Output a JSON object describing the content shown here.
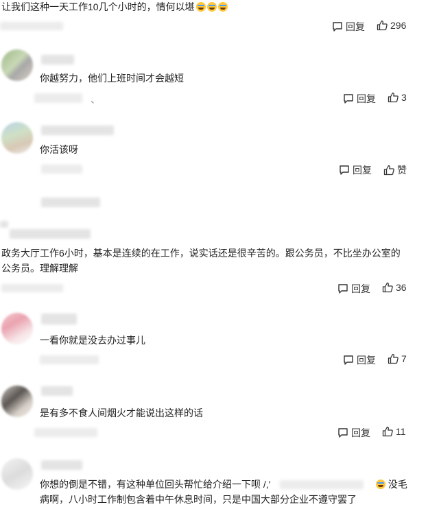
{
  "top": {
    "text": "让我们这种一天工作10几个小时的，情何以堪",
    "emoji": "😭😭😭",
    "reply": "回复",
    "likes": "296"
  },
  "comments": [
    {
      "text": "你越努力，他们上班时间才会越短",
      "reply": "回复",
      "likes": "3",
      "tail": "、"
    },
    {
      "text": "你活该呀",
      "reply": "回复",
      "likes": "赞"
    },
    {
      "text1": "政务大厅工作6小时，基本是连续的在工作，说实话还是很辛苦的。跟公务员，不比坐办公室的",
      "text2": "公务员。理解理解",
      "reply": "回复",
      "likes": "36"
    },
    {
      "text": "一看你就是没去办过事儿",
      "reply": "回复",
      "likes": "7"
    },
    {
      "text": "是有多不食人间烟火才能说出这样的话",
      "reply": "回复",
      "likes": "11"
    },
    {
      "text1a": "你想的倒是不错，有这种单位回头帮忙给介绍一下呗 /,'",
      "text1b": "没毛",
      "text2": "病啊，八小时工作制包含着中午休息时间，只是中国大部分企业不遵守罢了",
      "emoji": "😪"
    }
  ],
  "colors": {
    "text": "#222222",
    "action": "#333333",
    "blur": "#e4e4e4"
  },
  "icons": {
    "reply": "comment-bubble-icon",
    "like": "thumbs-up-icon"
  }
}
